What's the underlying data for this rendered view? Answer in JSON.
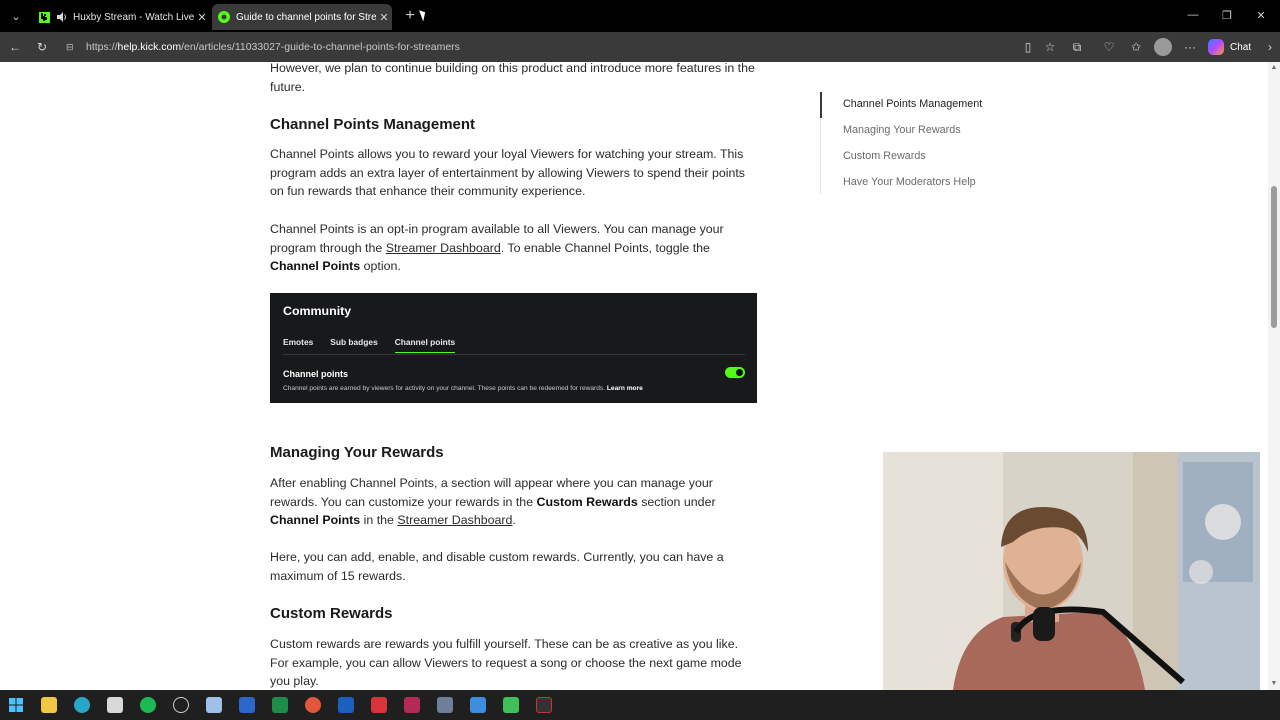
{
  "browser": {
    "tabs": [
      {
        "title": "Huxby Stream - Watch Live on Kick",
        "favicon_color": "#53fc18",
        "active": false,
        "audio": true
      },
      {
        "title": "Guide to channel points for Streamers",
        "favicon_color": "#53fc18",
        "active": true,
        "audio": false
      }
    ],
    "url_prefix": "https://",
    "url_host": "help.kick.com",
    "url_path": "/en/articles/11033027-guide-to-channel-points-for-streamers",
    "chat_label": "Chat"
  },
  "article": {
    "intro_continuation": "However, we plan to continue building on this product and introduce more features in the future.",
    "sections": {
      "management": {
        "heading": "Channel Points Management",
        "p1": "Channel Points allows you to reward your loyal Viewers for watching your stream. This program adds an extra layer of entertainment by allowing Viewers to spend their points on fun rewards that enhance their community experience.",
        "p2_a": "Channel Points is an opt-in program available to all Viewers. You can manage your program through the ",
        "p2_link": "Streamer Dashboard",
        "p2_b": ". To enable Channel Points, toggle the ",
        "p2_bold": "Channel Points",
        "p2_c": " option."
      },
      "managing": {
        "heading": "Managing Your Rewards",
        "p1_a": "After enabling Channel Points, a section will appear where you can manage your rewards. You can customize your rewards in the ",
        "p1_bold1": "Custom Rewards",
        "p1_b": " section under ",
        "p1_bold2": "Channel Points",
        "p1_c": " in the ",
        "p1_link": "Streamer Dashboard",
        "p1_d": ".",
        "p2": "Here, you can add, enable, and disable custom rewards. Currently, you can have a maximum of 15 rewards."
      },
      "custom": {
        "heading": "Custom Rewards",
        "p1": "Custom rewards are rewards you fulfill yourself. These can be as creative as you like. For example, you can allow Viewers to request a song or choose the next game mode you play."
      }
    },
    "screenshot": {
      "title": "Community",
      "tabs": [
        "Emotes",
        "Sub badges",
        "Channel points"
      ],
      "active_tab": "Channel points",
      "setting_title": "Channel points",
      "setting_desc": "Channel points are earned by viewers for activity on your channel. These points can be redeemed for rewards.",
      "learn_more": "Learn more",
      "toggle_on": true,
      "accent": "#53fc18"
    }
  },
  "toc": {
    "items": [
      "Channel Points Management",
      "Managing Your Rewards",
      "Custom Rewards",
      "Have Your Moderators Help"
    ],
    "active_index": 0
  },
  "taskbar": {
    "icons": [
      "windows-start-icon",
      "file-explorer-icon",
      "edge-icon",
      "app-icon",
      "spotify-icon",
      "clock-icon",
      "notepad-icon",
      "word-icon",
      "excel-icon",
      "app-icon",
      "app-icon",
      "filezilla-icon",
      "app-icon",
      "app-icon",
      "app-icon",
      "app-icon",
      "app-icon"
    ]
  }
}
